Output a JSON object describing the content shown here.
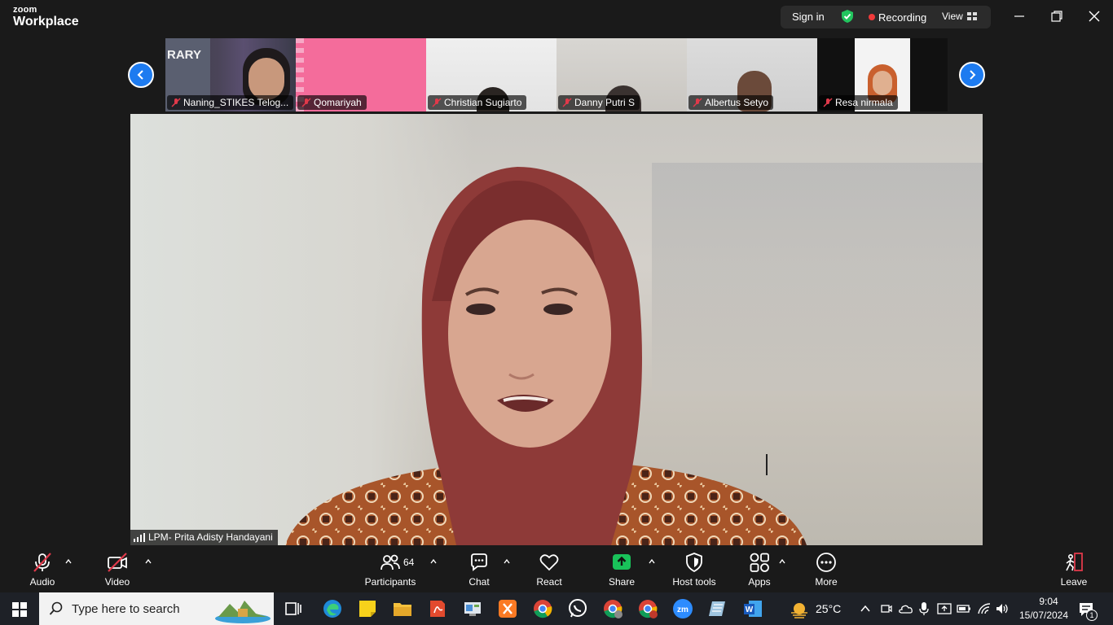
{
  "app": {
    "logo_top": "zoom",
    "logo_bottom": "Workplace",
    "sign_in": "Sign in",
    "recording": "Recording",
    "view": "View"
  },
  "participants_strip": [
    {
      "name": "Naning_STIKES Telog...",
      "background_text": "RARY"
    },
    {
      "name": "Qomariyah"
    },
    {
      "name": "Christian Sugiarto"
    },
    {
      "name": "Danny Putri S"
    },
    {
      "name": "Albertus Setyo"
    },
    {
      "name": "Resa nirmala"
    }
  ],
  "main_speaker": {
    "name": "LPM- Prita Adisty Handayani"
  },
  "toolbar": {
    "audio": "Audio",
    "video": "Video",
    "participants": "Participants",
    "participants_count": "64",
    "chat": "Chat",
    "react": "React",
    "share": "Share",
    "host_tools": "Host tools",
    "apps": "Apps",
    "more": "More",
    "leave": "Leave"
  },
  "taskbar": {
    "search_placeholder": "Type here to search",
    "weather": "25°C",
    "time": "9:04",
    "date": "15/07/2024",
    "notification_count": "1"
  },
  "colors": {
    "accent_blue": "#1d7bf0",
    "recording_red": "#f03a3a",
    "share_green": "#19c25a",
    "mute_red": "#e0394a"
  }
}
